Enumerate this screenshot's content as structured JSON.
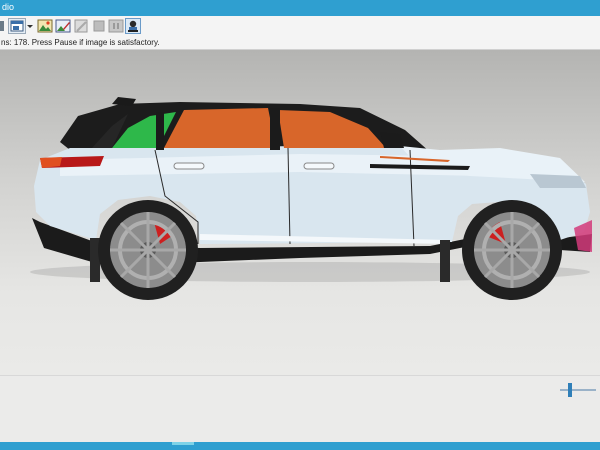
{
  "window": {
    "title_fragment": "dio"
  },
  "toolbar": {
    "buttons": [
      {
        "name": "window-button",
        "icon": "window-icon"
      },
      {
        "name": "dropdown-button",
        "icon": "chevron-down-icon"
      },
      {
        "name": "image-button",
        "icon": "image-icon"
      },
      {
        "name": "edit-image-button",
        "icon": "edit-image-icon"
      },
      {
        "name": "crop-button",
        "icon": "crop-icon"
      },
      {
        "name": "stop-button",
        "icon": "stop-icon"
      },
      {
        "name": "pause-button",
        "icon": "pause-icon"
      },
      {
        "name": "render-settings-button",
        "icon": "render-icon"
      }
    ]
  },
  "status": {
    "message": "ns: 178.  Press Pause if image is satisfactory."
  },
  "colors": {
    "titlebar": "#2f9fd0",
    "car_body": "#d9e6ef",
    "window_green": "#2eb84a",
    "window_orange": "#d8662a",
    "roof": "#1c1c1c",
    "brake": "#cc2020"
  }
}
